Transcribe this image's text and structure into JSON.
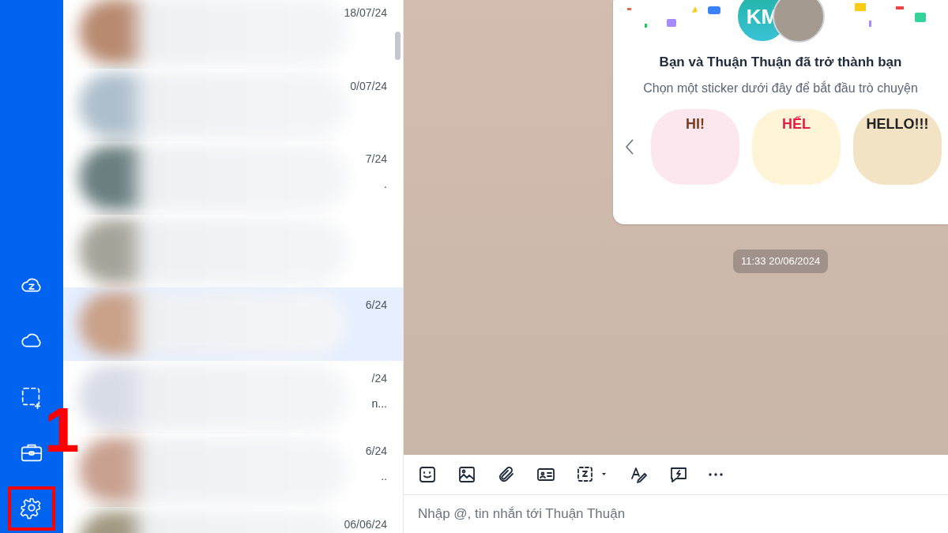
{
  "sidebar": {
    "items": [
      {
        "highlighted": false
      },
      {
        "highlighted": false
      },
      {
        "highlighted": false
      },
      {
        "highlighted": false
      },
      {
        "highlighted": true
      }
    ]
  },
  "callout": {
    "label": "1"
  },
  "chat_list": {
    "rows": [
      {
        "date": "18/07/24",
        "selected": false,
        "tail": ""
      },
      {
        "date": "0/07/24",
        "selected": false,
        "tail": ""
      },
      {
        "date": "7/24",
        "selected": false,
        "tail": "."
      },
      {
        "date": "",
        "selected": false,
        "tail": ""
      },
      {
        "date": "6/24",
        "selected": true,
        "tail": ""
      },
      {
        "date": "/24",
        "selected": false,
        "tail": "n..."
      },
      {
        "date": "6/24",
        "selected": false,
        "tail": ".."
      },
      {
        "date": "06/06/24",
        "selected": false,
        "tail": ""
      }
    ]
  },
  "friend_card": {
    "avatar_initials": "KM",
    "title": "Bạn và Thuận Thuận đã trở thành bạn",
    "subtitle": "Chọn một sticker dưới đây để bắt đầu trò chuyện",
    "stickers": [
      {
        "caption": "HI!"
      },
      {
        "caption": "HẾL"
      },
      {
        "caption": "HELLO!!!"
      }
    ]
  },
  "timestamp": "11:33 20/06/2024",
  "composer": {
    "placeholder": "Nhập @, tin nhắn tới Thuận Thuận"
  }
}
